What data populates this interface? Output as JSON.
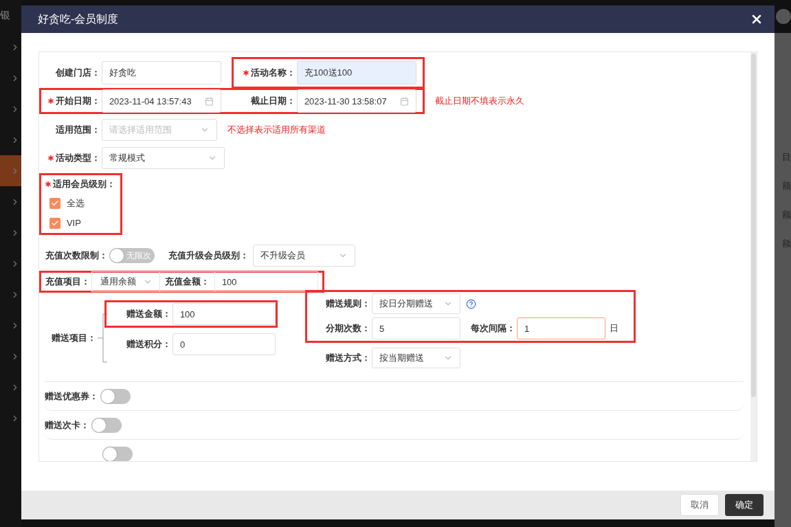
{
  "background": {
    "sidebar_title": "银",
    "sidebar_items": [
      {
        "selected": false
      },
      {
        "selected": false
      },
      {
        "selected": false
      },
      {
        "selected": false
      },
      {
        "selected": true
      },
      {
        "selected": false
      },
      {
        "selected": false
      },
      {
        "selected": false
      },
      {
        "selected": false
      },
      {
        "selected": false
      },
      {
        "selected": false
      },
      {
        "selected": false
      },
      {
        "selected": false
      }
    ],
    "table_fragments": [
      "目",
      "额",
      "额",
      "额"
    ]
  },
  "dialog": {
    "title": "好贪吃-会员制度",
    "store": {
      "label": "创建门店：",
      "value": "好贪吃"
    },
    "activity_name": {
      "label": "活动名称：",
      "required": true,
      "value": "充100送100",
      "annotated": true
    },
    "dates": {
      "annotated": true,
      "start": {
        "label": "开始日期：",
        "required": true,
        "value": "2023-11-04 13:57:43"
      },
      "end": {
        "label": "截止日期：",
        "required": false,
        "value": "2023-11-30 13:58:07"
      },
      "hint": "截止日期不填表示永久"
    },
    "scope": {
      "label": "适用范围：",
      "required": false,
      "placeholder": "请选择适用范围",
      "hint": "不选择表示适用所有渠道"
    },
    "activity_type": {
      "label": "活动类型：",
      "required": true,
      "value": "常规模式"
    },
    "member_levels": {
      "label": "适用会员级别：",
      "required": true,
      "annotated": true,
      "options": [
        {
          "label": "全选",
          "checked": true
        },
        {
          "label": "VIP",
          "checked": true
        }
      ]
    },
    "recharge_limit": {
      "label": "充值次数限制：",
      "on": false,
      "toggle_text": "无限次"
    },
    "upgrade_level": {
      "label": "充值升级会员级别：",
      "value": "不升级会员"
    },
    "recharge": {
      "annotated": true,
      "item_label": "充值项目：",
      "item_value": "通用余额",
      "amount_label": "充值金额：",
      "amount_value": "100"
    },
    "gift": {
      "label": "赠送项目：",
      "items": [
        {
          "label": "赠送金额：",
          "value": "100",
          "annotated": true
        },
        {
          "label": "赠送积分：",
          "value": "0",
          "annotated": false
        }
      ],
      "rule_annotated": true,
      "rule": {
        "label": "赠送规则：",
        "value": "按日分期赠送"
      },
      "installments": {
        "label": "分期次数：",
        "value": "5"
      },
      "interval": {
        "label": "每次间隔：",
        "value": "1",
        "focused": true,
        "unit": "日"
      },
      "method": {
        "label": "赠送方式：",
        "value": "按当期赠送"
      }
    },
    "extras": [
      {
        "label": "赠送优惠券：",
        "on": false
      },
      {
        "label": "赠送次卡：",
        "on": false
      },
      {
        "on": false
      }
    ],
    "buttons": [
      {
        "label": "取消",
        "kind": "secondary"
      },
      {
        "label": "确定",
        "kind": "primary"
      }
    ]
  }
}
